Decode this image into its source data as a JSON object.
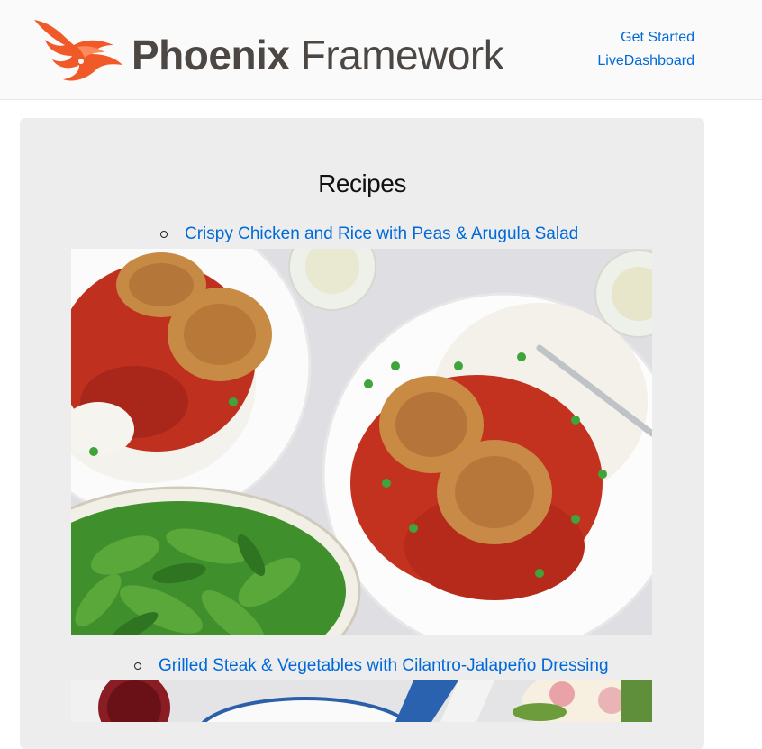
{
  "header": {
    "brand_bold": "Phoenix",
    "brand_light": "Framework",
    "nav": [
      {
        "label": "Get Started"
      },
      {
        "label": "LiveDashboard"
      }
    ]
  },
  "main": {
    "title": "Recipes",
    "recipes": [
      {
        "name": "Crispy Chicken and Rice with Peas & Arugula Salad",
        "image": "chicken-rice-photo"
      },
      {
        "name": "Grilled Steak & Vegetables with Cilantro-Jalapeño Dressing",
        "image": "steak-vegetables-photo"
      }
    ]
  },
  "colors": {
    "link": "#0069d9",
    "brand_orange": "#f05a28",
    "panel": "#ededed"
  }
}
